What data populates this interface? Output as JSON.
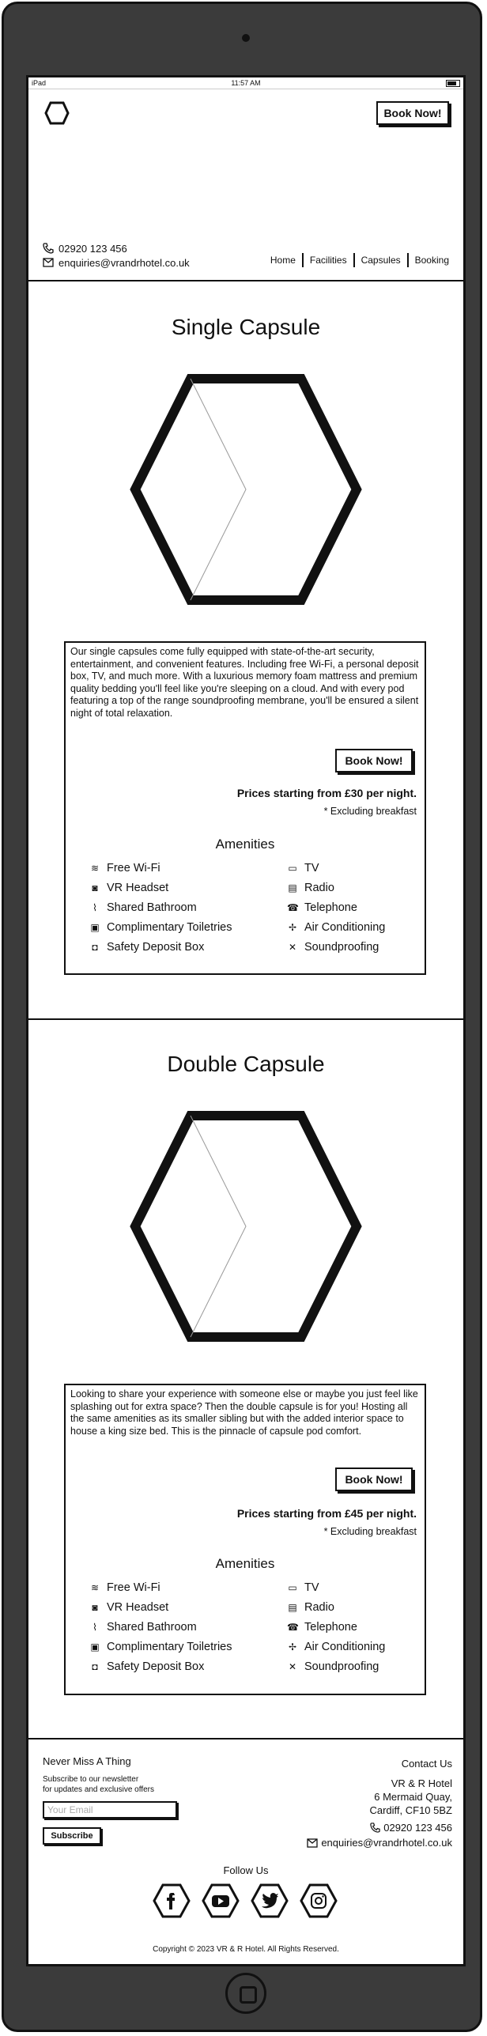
{
  "status": {
    "carrier": "iPad",
    "time": "11:57 AM"
  },
  "header": {
    "book_label": "Book Now!",
    "phone": "02920 123 456",
    "email": "enquiries@vrandrhotel.co.uk",
    "nav": [
      "Home",
      "Facilities",
      "Capsules",
      "Booking"
    ]
  },
  "single": {
    "title": "Single Capsule",
    "description": "Our single capsules come fully equipped with state-of-the-art security, entertainment, and convenient features. Including free Wi-Fi, a personal deposit box, TV, and much more. With a luxurious memory foam mattress and premium quality bedding you'll feel like you're sleeping on a cloud. And with every pod featuring a top of the range soundproofing membrane, you'll be ensured a silent night of total relaxation.",
    "book_label": "Book Now!",
    "price": "Prices starting from £30 per night.",
    "note": "* Excluding breakfast",
    "amenities_title": "Amenities"
  },
  "double": {
    "title": "Double Capsule",
    "description": "Looking to share your experience with someone else or maybe you just feel like splashing out for extra space? Then the double capsule is for you! Hosting all the same amenities as its smaller sibling but with the added interior space to house a king size bed. This is the pinnacle of capsule pod comfort.",
    "book_label": "Book Now!",
    "price": "Prices starting from £45 per night.",
    "note": "* Excluding breakfast",
    "amenities_title": "Amenities"
  },
  "amenities": {
    "left": [
      "Free Wi-Fi",
      "VR Headset",
      "Shared Bathroom",
      "Complimentary Toiletries",
      "Safety Deposit Box"
    ],
    "right": [
      "TV",
      "Radio",
      "Telephone",
      "Air Conditioning",
      "Soundproofing"
    ]
  },
  "footer": {
    "newsletter_title": "Never Miss A Thing",
    "newsletter_line1": "Subscribe to our newsletter",
    "newsletter_line2": "for updates and exclusive offers",
    "email_placeholder": "Your Email",
    "subscribe_label": "Subscribe",
    "contact_title": "Contact Us",
    "address1": "VR & R Hotel",
    "address2": "6 Mermaid Quay,",
    "address3": "Cardiff, CF10 5BZ",
    "phone": "02920 123 456",
    "email": "enquiries@vrandrhotel.co.uk",
    "follow": "Follow Us",
    "copyright": "Copyright © 2023 VR & R Hotel. All Rights Reserved."
  }
}
